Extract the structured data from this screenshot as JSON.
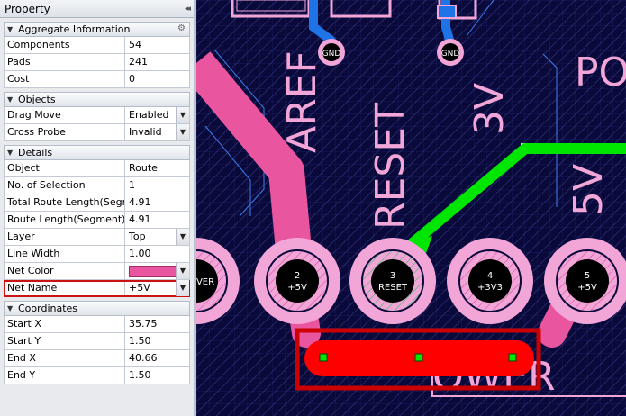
{
  "panel": {
    "title": "Property",
    "pin_glyph": "◂◂",
    "sections": {
      "aggregate": {
        "title": "Aggregate Information",
        "rows": [
          [
            "Components",
            "54"
          ],
          [
            "Pads",
            "241"
          ],
          [
            "Cost",
            "0"
          ]
        ]
      },
      "objects": {
        "title": "Objects",
        "rows": [
          [
            "Drag Move",
            "Enabled"
          ],
          [
            "Cross Probe",
            "Invalid"
          ]
        ]
      },
      "details": {
        "title": "Details",
        "rows": [
          [
            "Object",
            "Route"
          ],
          [
            "No. of Selection",
            "1"
          ],
          [
            "Total Route Length(Segment)",
            "4.91"
          ],
          [
            "Route Length(Segment)",
            "4.91"
          ],
          [
            "Layer",
            "Top"
          ],
          [
            "Line Width",
            "1.00"
          ],
          [
            "Net Color",
            ""
          ],
          [
            "Net Name",
            "+5V"
          ]
        ]
      },
      "coordinates": {
        "title": "Coordinates",
        "rows": [
          [
            "Start X",
            "35.75"
          ],
          [
            "Start Y",
            "1.50"
          ],
          [
            "End X",
            "40.66"
          ],
          [
            "End Y",
            "1.50"
          ]
        ]
      }
    },
    "net_color": "#e9559f"
  },
  "board": {
    "silk_labels": [
      "AREF",
      "RESET",
      "3V",
      "5V",
      "PO",
      "OWER"
    ],
    "gnd_labels": [
      "GND",
      "GND"
    ],
    "header_pins": [
      {
        "num": "2",
        "net": "+5V"
      },
      {
        "num": "3",
        "net": "RESET"
      },
      {
        "num": "4",
        "net": "+3V3"
      },
      {
        "num": "5",
        "net": "+5V"
      }
    ],
    "left_pad_label": "VER",
    "colors": {
      "background": "#0a0a3a",
      "trace_pink": "#e9559f",
      "trace_green": "#00e600",
      "selected_red": "#ff0000",
      "pad_pink": "#f2a6d8",
      "via_blue": "#1e73e6"
    }
  }
}
